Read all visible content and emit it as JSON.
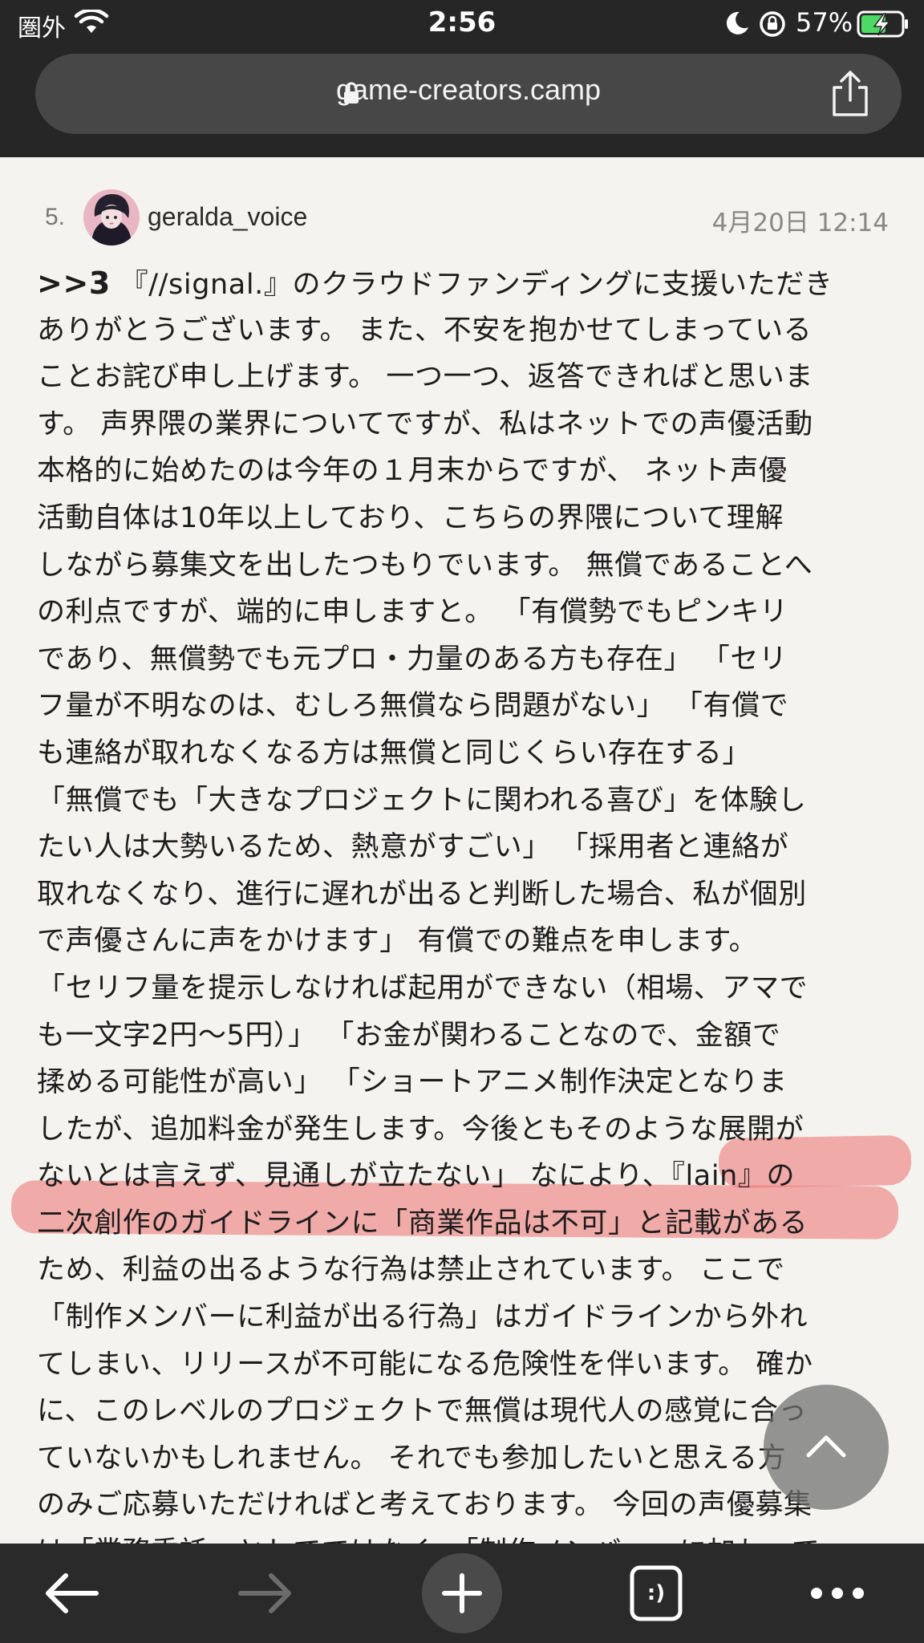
{
  "status_bar": {
    "carrier": "圏外",
    "time": "2:56",
    "battery_percent": "57%"
  },
  "browser": {
    "url": "game-creators.camp"
  },
  "post": {
    "number": "5.",
    "username": "geralda_voice",
    "date": "4月20日 12:14",
    "reply_ref": ">>3",
    "lines": [
      " 『//signal.』のクラウドファンディングに支援いただき",
      "ありがとうございます。 また、不安を抱かせてしまっている",
      "ことお詫び申し上げます。 一つ一つ、返答できればと思いま",
      "す。 声界隈の業界についてですが、私はネットでの声優活動",
      "本格的に始めたのは今年の１月末からですが、 ネット声優",
      "活動自体は10年以上しており、こちらの界隈について理解",
      "しながら募集文を出したつもりでいます。 無償であることへ",
      "の利点ですが、端的に申しますと。 「有償勢でもピンキリ",
      "であり、無償勢でも元プロ・力量のある方も存在」 「セリ",
      "フ量が不明なのは、むしろ無償なら問題がない」 「有償で",
      "も連絡が取れなくなる方は無償と同じくらい存在する」",
      "「無償でも「大きなプロジェクトに関われる喜び」を体験し",
      "たい人は大勢いるため、熱意がすごい」 「採用者と連絡が",
      "取れなくなり、進行に遅れが出ると判断した場合、私が個別",
      "で声優さんに声をかけます」 有償での難点を申します。",
      "「セリフ量を提示しなければ起用ができない（相場、アマで",
      "も一文字2円〜5円）」 「お金が関わることなので、金額で",
      "揉める可能性が高い」 「ショートアニメ制作決定となりま",
      "したが、追加料金が発生します。今後ともそのような展開が",
      "ないとは言えず、見通しが立たない」 なにより、『lain』の",
      "二次創作のガイドラインに「商業作品は不可」と記載がある",
      "ため、利益の出るような行為は禁止されています。 ここで",
      "「制作メンバーに利益が出る行為」はガイドラインから外れ",
      "てしまい、リリースが不可能になる危険性を伴います。 確か",
      "に、このレベルのプロジェクトで無償は現代人の感覚に合っ",
      "ていないかもしれません。 それでも参加したいと思える方",
      "のみご応募いただければと考えております。 今回の声優募集",
      "は「業務委託」としてではなく、「制作メンバー」に加わって"
    ]
  },
  "toolbar": {
    "tabs_label": ":)"
  },
  "icons": {
    "wifi": "wifi-icon",
    "moon": "moon-icon",
    "rotation_lock": "rotation-lock-icon",
    "battery": "battery-charging-icon",
    "lock": "lock-icon",
    "share": "share-icon",
    "back": "arrow-left-icon",
    "forward": "arrow-right-icon",
    "new_tab": "plus-icon",
    "tabs": "tabs-icon",
    "more": "more-icon",
    "scroll_top": "chevron-up-icon"
  },
  "colors": {
    "chrome": "#262626",
    "page_bg": "#f4f3ef",
    "highlight": "#ec6e6e",
    "battery_fill": "#4cd964"
  }
}
